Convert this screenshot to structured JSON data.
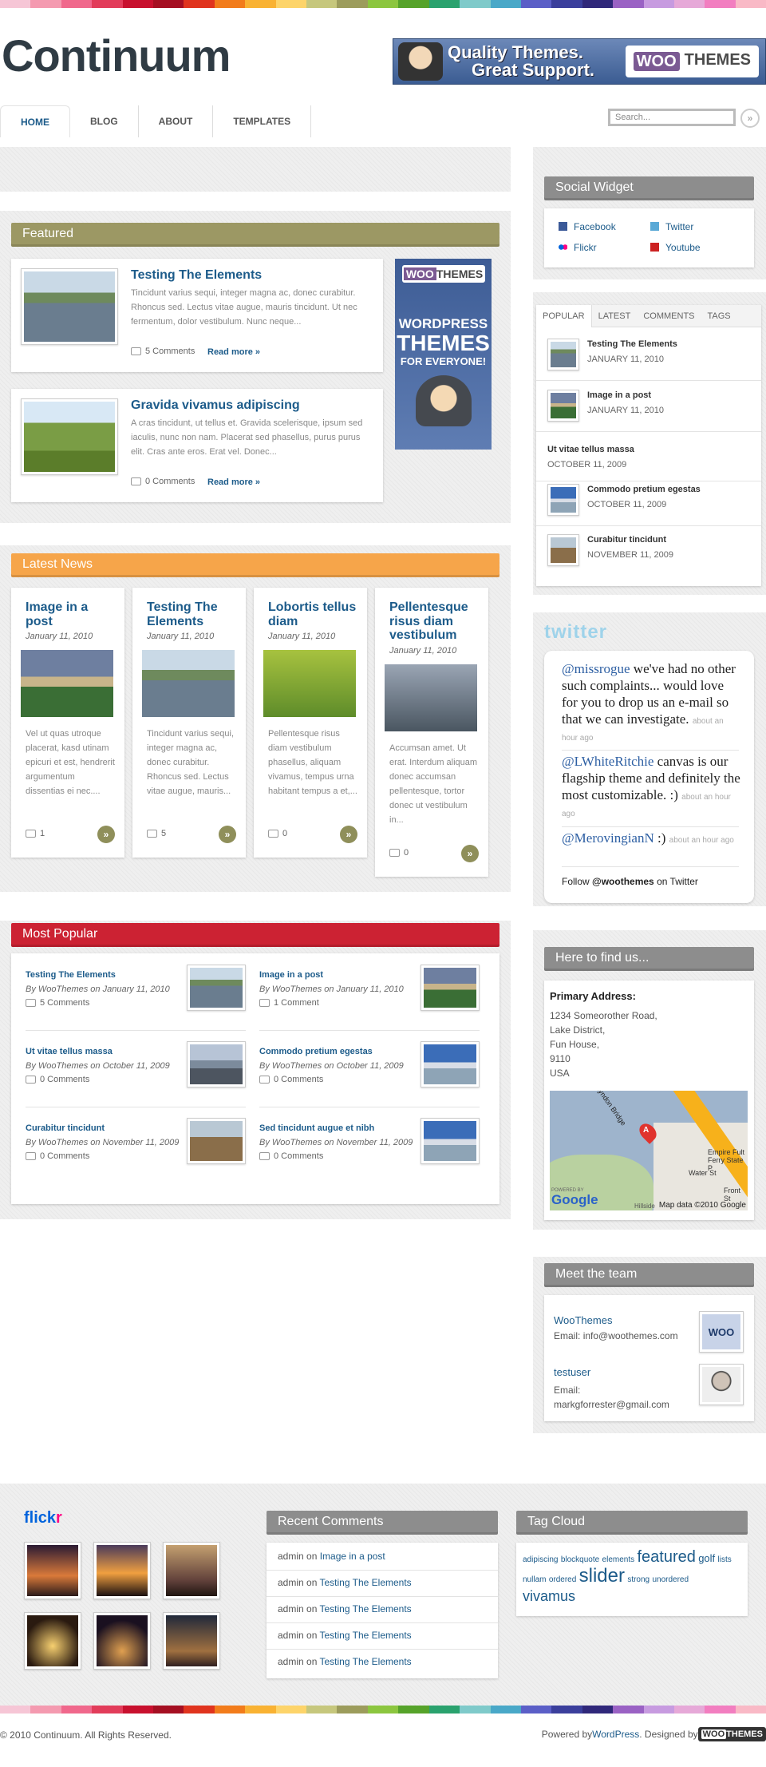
{
  "stripe_colors": [
    "#f6c6d6",
    "#f49ab0",
    "#f0688c",
    "#e23c5a",
    "#c8102e",
    "#a50f22",
    "#e0341e",
    "#f27c1b",
    "#f9b233",
    "#fdd46a",
    "#c6c77d",
    "#9c9c5c",
    "#8cc63f",
    "#56a32a",
    "#2aa26e",
    "#7fcaca",
    "#49a8c8",
    "#5b5fc7",
    "#3b3f9c",
    "#30287a",
    "#9a62c4",
    "#c79be0",
    "#e6a9d8",
    "#f27ec0",
    "#f9b9c6"
  ],
  "site": {
    "title": "Continuum"
  },
  "banner": {
    "line1": "Quality Themes.",
    "line2": "Great Support.",
    "brand_a": "WOO",
    "brand_b": "THEMES"
  },
  "nav": {
    "items": [
      "HOME",
      "BLOG",
      "ABOUT",
      "TEMPLATES"
    ],
    "active": "HOME"
  },
  "search": {
    "placeholder": "Search..."
  },
  "featured": {
    "heading": "Featured",
    "color": "#9c9864",
    "posts": [
      {
        "title": "Testing The Elements",
        "excerpt": "Tincidunt varius sequi, integer magna ac, donec curabitur. Rhoncus sed. Lectus vitae augue, mauris tincidunt. Ut nec fermentum, dolor vestibulum. Nunc neque...",
        "comments": "5 Comments",
        "read_more": "Read more »"
      },
      {
        "title": "Gravida vivamus adipiscing",
        "excerpt": "A cras tincidunt, ut tellus et. Gravida scelerisque, ipsum sed iaculis, nunc non nam. Placerat sed phasellus, purus purus elit. Cras ante eros. Erat vel. Donec...",
        "comments": "0 Comments",
        "read_more": "Read more »"
      }
    ],
    "ad": {
      "brand_a": "WOO",
      "brand_b": "THEMES",
      "line1": "WORDPRESS",
      "line2": "THEMES",
      "line3": "FOR EVERYONE!"
    }
  },
  "latest": {
    "heading": "Latest News",
    "color": "#f6a54a",
    "posts": [
      {
        "title": "Image in a post",
        "date": "January 11, 2010",
        "excerpt": "Vel ut quas utroque placerat, kasd utinam epicuri et est, hendrerit argumentum dissentias ei nec....",
        "comments": "1"
      },
      {
        "title": "Testing The Elements",
        "date": "January 11, 2010",
        "excerpt": "Tincidunt varius sequi, integer magna ac, donec curabitur. Rhoncus sed. Lectus vitae augue, mauris...",
        "comments": "5"
      },
      {
        "title": "Lobortis tellus diam",
        "date": "January 11, 2010",
        "excerpt": "Pellentesque risus diam vestibulum phasellus, aliquam vivamus, tempus urna habitant tempus a et,...",
        "comments": "0"
      },
      {
        "title": "Pellentesque risus diam vestibulum",
        "date": "January 11, 2010",
        "excerpt": "Accumsan amet. Ut erat. Interdum aliquam donec accumsan pellentesque, tortor donec ut vestibulum in...",
        "comments": "0"
      }
    ]
  },
  "popular": {
    "heading": "Most Popular",
    "color": "#cc2233",
    "posts": [
      {
        "title": "Testing The Elements",
        "meta": "By WooThemes on January 11, 2010",
        "comments": "5 Comments"
      },
      {
        "title": "Image in a post",
        "meta": "By WooThemes on January 11, 2010",
        "comments": "1 Comment"
      },
      {
        "title": "Ut vitae tellus massa",
        "meta": "By WooThemes on October 11, 2009",
        "comments": "0 Comments"
      },
      {
        "title": "Commodo pretium egestas",
        "meta": "By WooThemes on October 11, 2009",
        "comments": "0 Comments"
      },
      {
        "title": "Curabitur tincidunt",
        "meta": "By WooThemes on November 11, 2009",
        "comments": "0 Comments"
      },
      {
        "title": "Sed tincidunt augue et nibh",
        "meta": "By WooThemes on November 11, 2009",
        "comments": "0 Comments"
      }
    ]
  },
  "social": {
    "heading": "Social Widget",
    "links": [
      "Facebook",
      "Twitter",
      "Flickr",
      "Youtube"
    ]
  },
  "tabs": {
    "labels": [
      "POPULAR",
      "LATEST",
      "COMMENTS",
      "TAGS"
    ],
    "items": [
      {
        "title": "Testing The Elements",
        "date": "JANUARY 11, 2010"
      },
      {
        "title": "Image in a post",
        "date": "JANUARY 11, 2010"
      },
      {
        "title": "Ut vitae tellus massa",
        "date": "OCTOBER 11, 2009"
      },
      {
        "title": "Commodo pretium egestas",
        "date": "OCTOBER 11, 2009"
      },
      {
        "title": "Curabitur tincidunt",
        "date": "NOVEMBER 11, 2009"
      }
    ]
  },
  "twitter": {
    "logo": "twitter",
    "tweets": [
      {
        "user": "@missrogue",
        "text": " we've had no other such complaints... would love for you to drop us an e-mail so that we can investigate.",
        "time": "about an hour ago"
      },
      {
        "user": "@LWhiteRitchie",
        "text": " canvas is our flagship theme and definitely the most customizable. :)",
        "time": "about an hour ago"
      },
      {
        "user": "@MerovingianN",
        "text": " :)",
        "time": "about an hour ago"
      }
    ],
    "follow_pre": "Follow ",
    "follow_user": "@woothemes",
    "follow_post": " on Twitter"
  },
  "findus": {
    "heading": "Here to find us...",
    "label": "Primary Address:",
    "lines": [
      "1234 Someorother Road,",
      "Lake District,",
      "Fun House,",
      "9110",
      "USA"
    ],
    "map_credit": "Map data ©2010 Google",
    "map_logo": "Google",
    "powered": "POWERED BY",
    "road": "Lyndon Bridge",
    "marker": "A",
    "places": [
      "Empire Fult",
      "Ferry State P",
      "Water St",
      "Front St",
      "Hillside"
    ]
  },
  "team": {
    "heading": "Meet the team",
    "members": [
      {
        "name": "WooThemes",
        "email_label": "Email: ",
        "email": "info@woothemes.com",
        "avatar": "WOO"
      },
      {
        "name": "testuser",
        "email_label": "Email: ",
        "email": "markgforrester@gmail.com"
      }
    ]
  },
  "flickr": {
    "logo_a": "flick",
    "logo_b": "r"
  },
  "recent_comments": {
    "heading": "Recent Comments",
    "items": [
      {
        "author": "admin",
        "on": " on ",
        "post": "Image in a post"
      },
      {
        "author": "admin",
        "on": " on ",
        "post": "Testing The Elements"
      },
      {
        "author": "admin",
        "on": " on ",
        "post": "Testing The Elements"
      },
      {
        "author": "admin",
        "on": " on ",
        "post": "Testing The Elements"
      },
      {
        "author": "admin",
        "on": " on ",
        "post": "Testing The Elements"
      }
    ]
  },
  "tagcloud": {
    "heading": "Tag Cloud",
    "tags": [
      "adipiscing",
      "blockquote",
      "elements",
      "featured",
      "golf",
      "lists",
      "nullam",
      "ordered",
      "slider",
      "strong",
      "unordered",
      "vivamus"
    ]
  },
  "footer": {
    "copyright": "© 2010 Continuum. All Rights Reserved.",
    "powered": "Powered by ",
    "wordpress": "WordPress",
    "designed": ". Designed by ",
    "brand_a": "WOO",
    "brand_b": "THEMES"
  }
}
